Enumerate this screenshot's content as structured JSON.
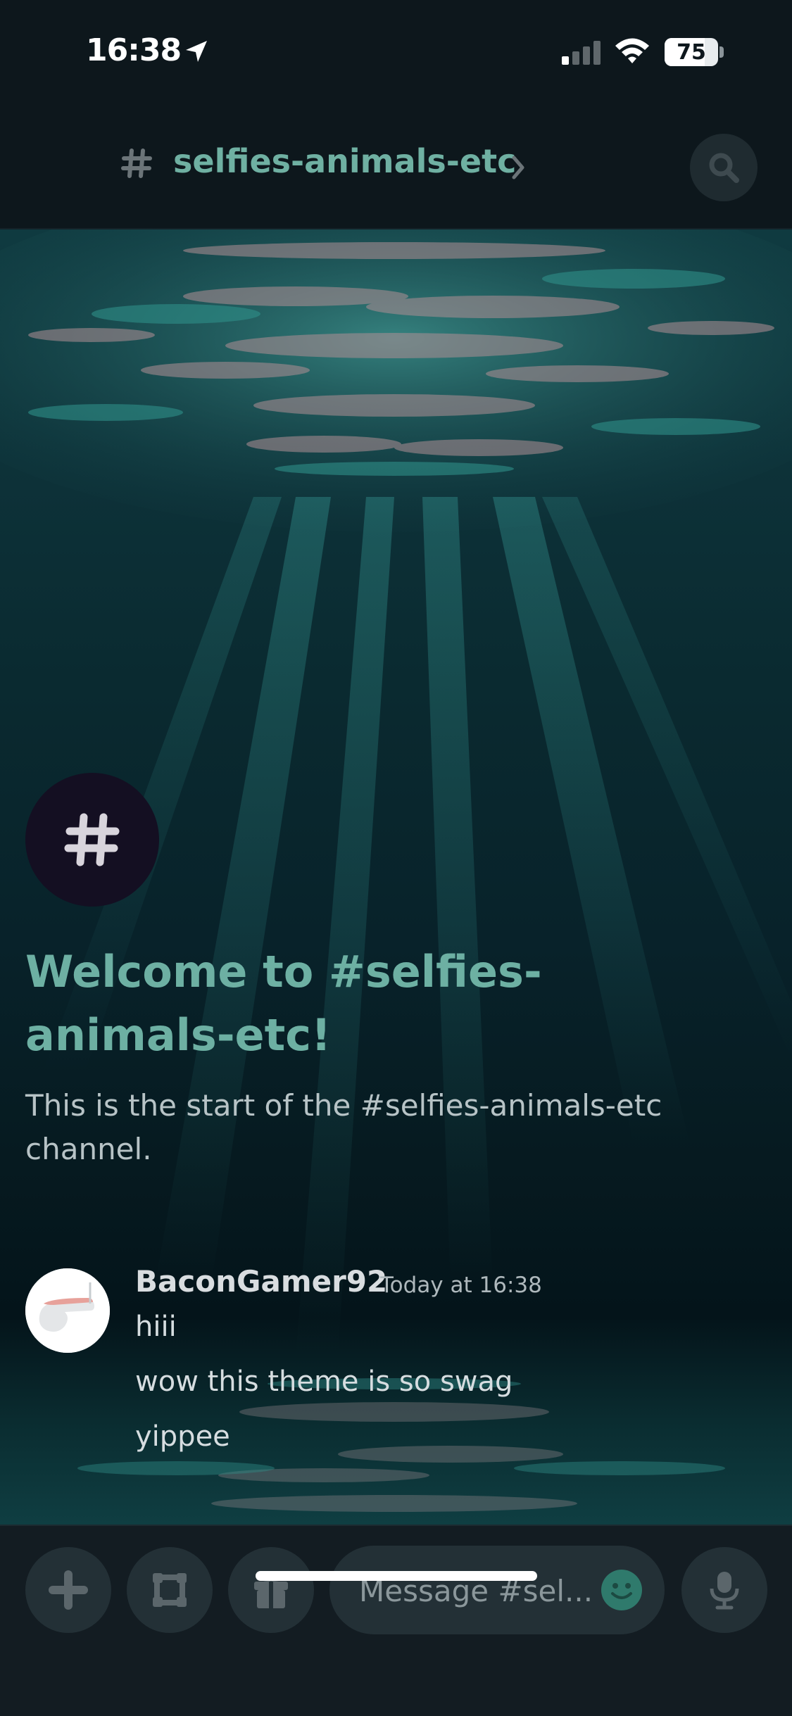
{
  "status_bar": {
    "time": "16:38",
    "battery": "75",
    "battery_level": 0.75
  },
  "header": {
    "channel_name": "selfies-animals-etc"
  },
  "intro": {
    "title": "Welcome to #selfies-animals-etc!",
    "subtitle": "This is the start of the #selfies-animals-etc channel."
  },
  "messages": [
    {
      "author": "BaconGamer92",
      "timestamp": "Today at 16:38",
      "lines": [
        "hiii",
        "wow this theme is so swag",
        "yippee"
      ]
    }
  ],
  "composer": {
    "placeholder": "Message #sel..."
  },
  "icons": {
    "location": "location-arrow-icon",
    "signal": "cellular-signal-icon",
    "wifi": "wifi-icon",
    "search": "search-icon",
    "add": "plus-icon",
    "apps": "apps-icon",
    "gift": "gift-icon",
    "emoji": "emoji-icon",
    "mic": "microphone-icon"
  },
  "colors": {
    "accent": "#6fb0a2",
    "background": "#0c1418"
  }
}
